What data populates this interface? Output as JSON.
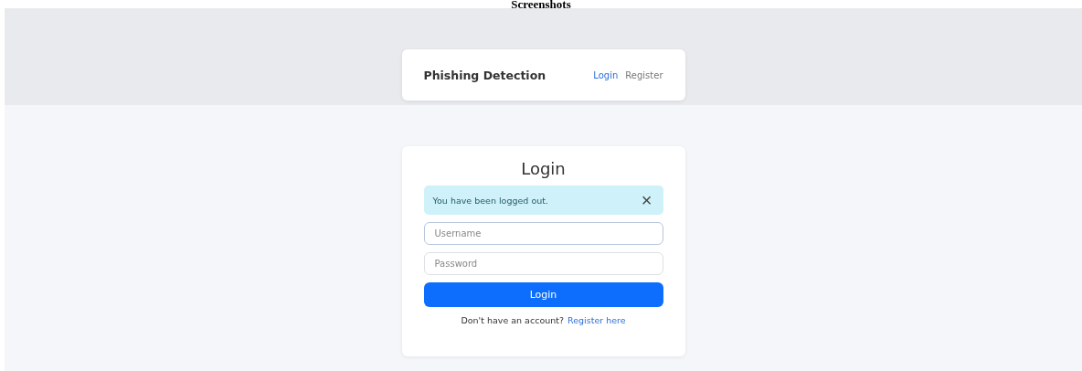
{
  "caption": "Screenshots",
  "navbar": {
    "brand": "Phishing Detection",
    "links": [
      {
        "label": "Login",
        "selected": true
      },
      {
        "label": "Register",
        "selected": false
      }
    ]
  },
  "login": {
    "title": "Login",
    "alert": {
      "message": "You have been logged out.",
      "close": "×"
    },
    "fields": [
      {
        "placeholder": "Username",
        "focused": true
      },
      {
        "placeholder": "Password",
        "focused": false
      }
    ],
    "button": "Login",
    "footer": "Don't have an account?",
    "footer_link": "Register here"
  }
}
